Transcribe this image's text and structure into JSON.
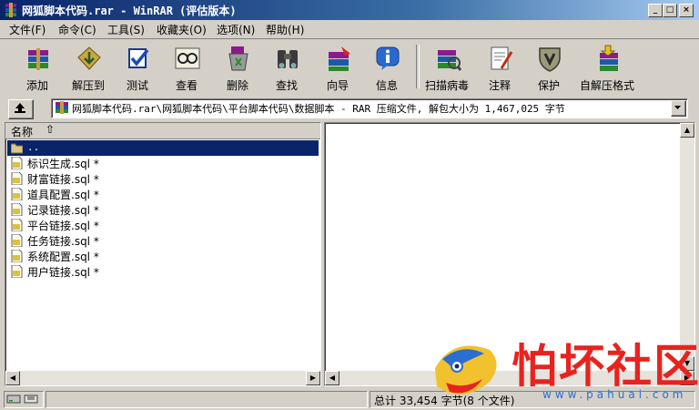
{
  "window": {
    "title": "网狐脚本代码.rar - WinRAR (评估版本)",
    "minimize_glyph": "_",
    "maximize_glyph": "□",
    "close_glyph": "×"
  },
  "menu": [
    {
      "label": "文件(F)"
    },
    {
      "label": "命令(C)"
    },
    {
      "label": "工具(S)"
    },
    {
      "label": "收藏夹(O)"
    },
    {
      "label": "选项(N)"
    },
    {
      "label": "帮助(H)"
    }
  ],
  "toolbar": [
    {
      "label": "添加",
      "icon": "add-archive-icon"
    },
    {
      "label": "解压到",
      "icon": "extract-to-icon"
    },
    {
      "label": "测试",
      "icon": "test-icon"
    },
    {
      "label": "查看",
      "icon": "view-icon"
    },
    {
      "label": "删除",
      "icon": "delete-icon"
    },
    {
      "label": "查找",
      "icon": "find-binoculars-icon"
    },
    {
      "label": "向导",
      "icon": "wizard-icon"
    },
    {
      "label": "信息",
      "icon": "info-icon"
    },
    {
      "label": "扫描病毒",
      "icon": "virus-scan-icon"
    },
    {
      "label": "注释",
      "icon": "comment-icon"
    },
    {
      "label": "保护",
      "icon": "protect-shield-icon"
    },
    {
      "label": "自解压格式",
      "icon": "sfx-icon"
    }
  ],
  "address": {
    "path": "网狐脚本代码.rar\\网狐脚本代码\\平台脚本代码\\数据脚本 - RAR 压缩文件, 解包大小为 1,467,025 字节"
  },
  "file_list": {
    "column_name": "名称",
    "sort_arrow": "⇧",
    "items": [
      {
        "name": "..",
        "type": "folder",
        "selected": true
      },
      {
        "name": "标识生成.sql *",
        "type": "file"
      },
      {
        "name": "财富链接.sql *",
        "type": "file"
      },
      {
        "name": "道具配置.sql *",
        "type": "file"
      },
      {
        "name": "记录链接.sql *",
        "type": "file"
      },
      {
        "name": "平台链接.sql *",
        "type": "file"
      },
      {
        "name": "任务链接.sql *",
        "type": "file"
      },
      {
        "name": "系统配置.sql *",
        "type": "file"
      },
      {
        "name": "用户链接.sql *",
        "type": "file"
      }
    ]
  },
  "status": {
    "summary": "总计 33,454 字节(8 个文件)"
  },
  "watermark": {
    "title": "怕坏社区",
    "url": "www.pahuai.com"
  },
  "colors": {
    "titlebar_start": "#0a246a",
    "selection": "#0a246a",
    "face": "#d4d0c8",
    "watermark_red": "#e8231f"
  }
}
